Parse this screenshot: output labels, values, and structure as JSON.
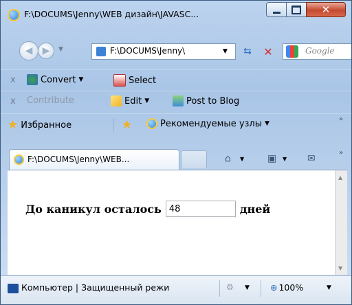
{
  "window": {
    "title": "F:\\DOCUMS\\Jenny\\WEB дизайн\\JAVASC...",
    "close_glyph": "✕"
  },
  "nav": {
    "back_icon": "back-arrow-icon",
    "forward_icon": "forward-arrow-icon",
    "address": "F:\\DOCUMS\\Jenny\\",
    "search_placeholder": "Google"
  },
  "toolbars": {
    "row1": {
      "close": "x",
      "convert": "Convert",
      "select": "Select"
    },
    "row2": {
      "close": "x",
      "contribute": "Contribute",
      "edit": "Edit",
      "post": "Post to Blog"
    },
    "favorites": {
      "favorites": "Избранное",
      "suggested": "Рекомендуемые узлы"
    }
  },
  "tabs": [
    {
      "label": "F:\\DOCUMS\\Jenny\\WEB..."
    }
  ],
  "content": {
    "prefix": "До каникул осталось",
    "days_value": "48",
    "suffix": "дней"
  },
  "status": {
    "text": "Компьютер | Защищенный режи",
    "zoom": "100%"
  },
  "colors": {
    "titlebar": "#bcd3ee",
    "close_button": "#c44a31",
    "page_background": "#ffffff"
  }
}
